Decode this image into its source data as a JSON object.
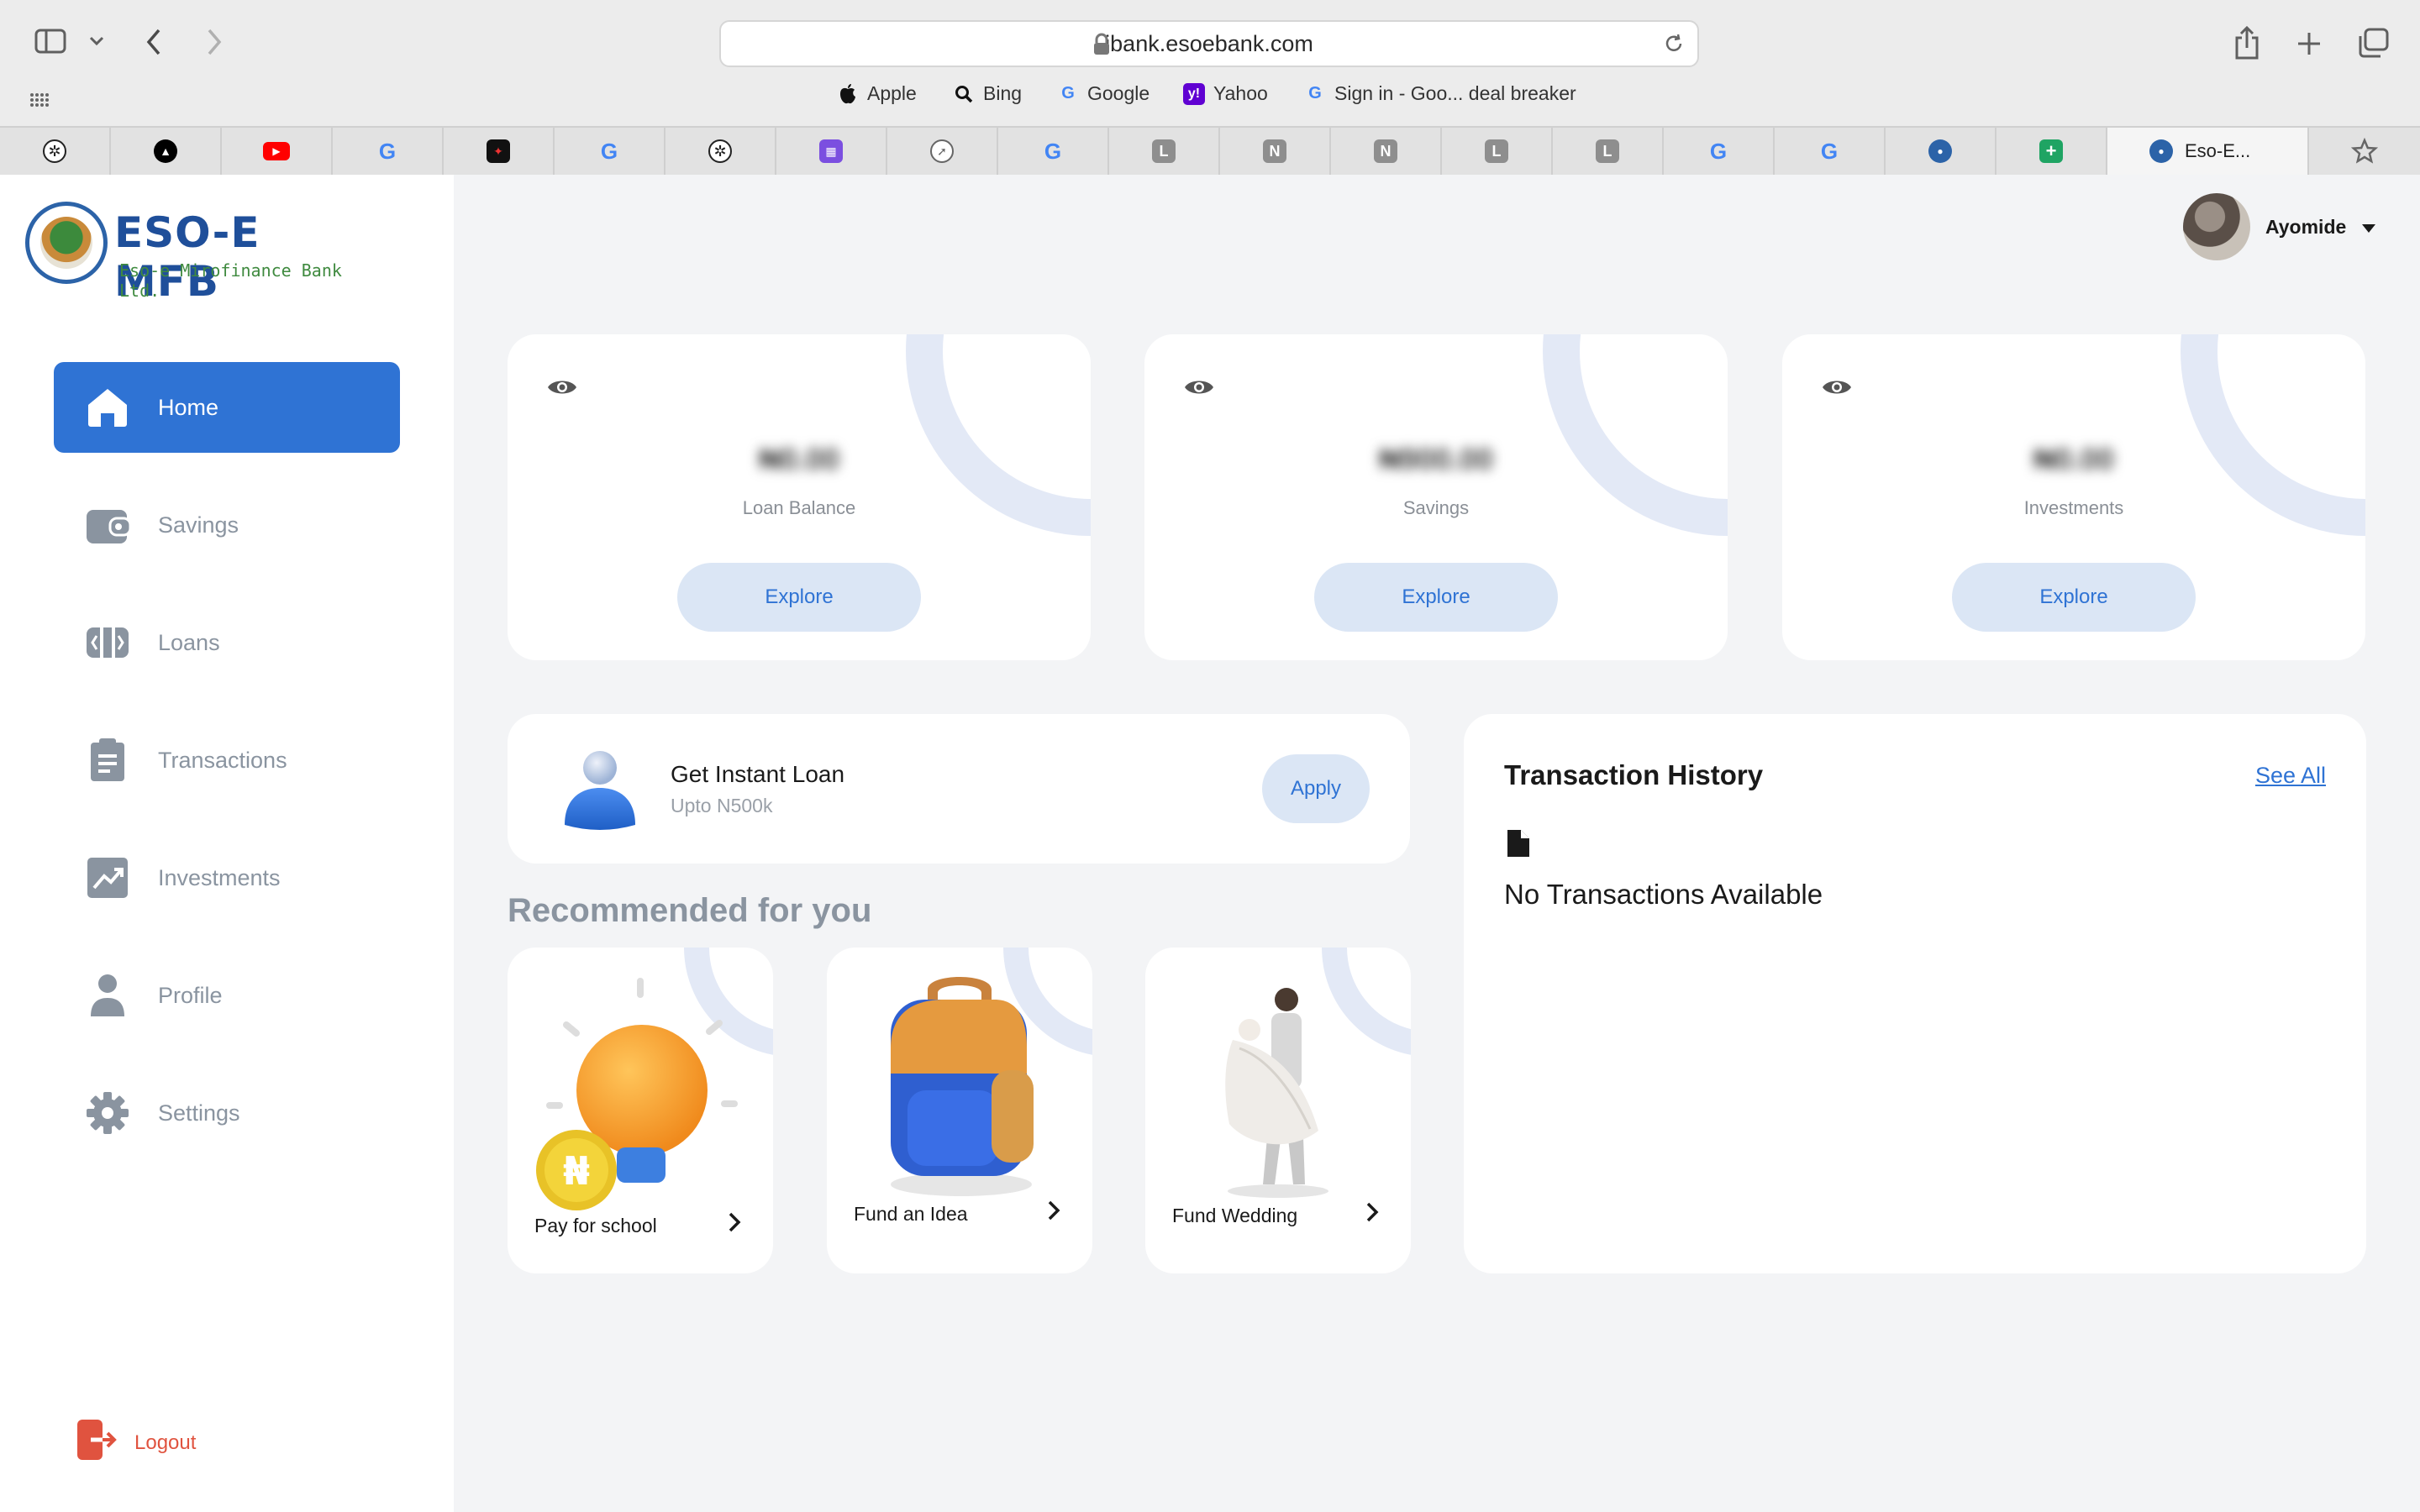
{
  "browser": {
    "url": "ibank.esoebank.com",
    "bookmarks": [
      {
        "label": "Apple",
        "icon": "apple-icon"
      },
      {
        "label": "Bing",
        "icon": "search-icon"
      },
      {
        "label": "Google",
        "icon": "google-icon"
      },
      {
        "label": "Yahoo",
        "icon": "yahoo-icon"
      },
      {
        "label": "Sign in - Goo... deal breaker",
        "icon": "google-icon"
      }
    ],
    "tabs": [
      {
        "icon": "openai-icon"
      },
      {
        "icon": "vercel-icon"
      },
      {
        "icon": "youtube-icon"
      },
      {
        "icon": "google-icon"
      },
      {
        "icon": "app-icon"
      },
      {
        "icon": "google-icon"
      },
      {
        "icon": "openai-icon"
      },
      {
        "icon": "calendar-icon"
      },
      {
        "icon": "compass-icon"
      },
      {
        "icon": "google-icon"
      },
      {
        "icon": "letter-l-icon",
        "letter": "L"
      },
      {
        "icon": "letter-n-icon",
        "letter": "N"
      },
      {
        "icon": "letter-n-icon",
        "letter": "N"
      },
      {
        "icon": "letter-l-icon",
        "letter": "L"
      },
      {
        "icon": "letter-l-icon",
        "letter": "L"
      },
      {
        "icon": "google-icon"
      },
      {
        "icon": "google-icon"
      },
      {
        "icon": "bank-seal-icon"
      },
      {
        "icon": "sheets-icon"
      }
    ],
    "active_tab": {
      "label": "Eso-E...",
      "icon": "bank-seal-icon"
    }
  },
  "logo": {
    "name": "ESO-E MFB",
    "subtitle": "Eso-e Mirofinance Bank Ltd."
  },
  "sidebar": {
    "items": [
      {
        "label": "Home",
        "icon": "home-icon",
        "active": true
      },
      {
        "label": "Savings",
        "icon": "wallet-icon",
        "active": false
      },
      {
        "label": "Loans",
        "icon": "loan-icon",
        "active": false
      },
      {
        "label": "Transactions",
        "icon": "clipboard-icon",
        "active": false
      },
      {
        "label": "Investments",
        "icon": "chart-up-icon",
        "active": false
      },
      {
        "label": "Profile",
        "icon": "user-icon",
        "active": false
      },
      {
        "label": "Settings",
        "icon": "gear-icon",
        "active": false
      }
    ],
    "logout": "Logout"
  },
  "user": {
    "name": "Ayomide"
  },
  "balances": [
    {
      "amount": "₦0.00",
      "caption": "Loan Balance",
      "button": "Explore"
    },
    {
      "amount": "₦900.00",
      "caption": "Savings",
      "button": "Explore"
    },
    {
      "amount": "₦0.00",
      "caption": "Investments",
      "button": "Explore"
    }
  ],
  "instant_loan": {
    "title": "Get Instant Loan",
    "subtitle": "Upto N500k",
    "button": "Apply"
  },
  "recommended": {
    "title": "Recommended for you",
    "items": [
      {
        "label": "Pay for school",
        "icon": "lightbulb-coin-icon"
      },
      {
        "label": "Fund an Idea",
        "icon": "backpack-icon"
      },
      {
        "label": "Fund Wedding",
        "icon": "wedding-couple-icon"
      }
    ]
  },
  "history": {
    "title": "Transaction History",
    "see_all": "See All",
    "empty": "No Transactions Available"
  },
  "colors": {
    "primary": "#2f73d4",
    "muted": "#8a94a0",
    "logout": "#e0533f",
    "button_bg": "#dbe6f5",
    "logo_blue": "#1f4f9a",
    "logo_green": "#3f8a3f"
  }
}
